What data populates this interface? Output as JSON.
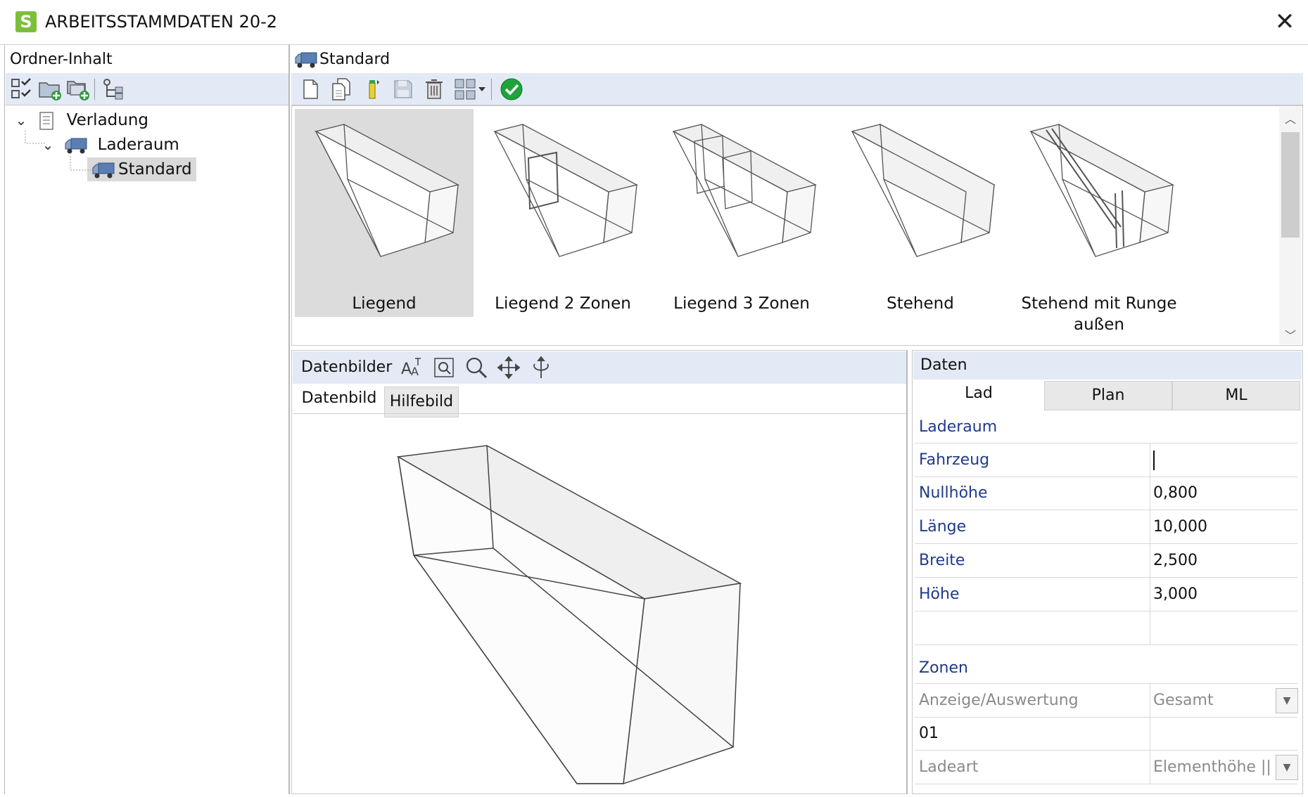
{
  "window": {
    "title": "ARBEITSSTAMMDATEN 20-2",
    "app_icon_letter": "S",
    "close_glyph": "✕"
  },
  "left": {
    "header": "Ordner-Inhalt",
    "toolbar": [
      "checklist-icon",
      "folder-add-icon",
      "folder-copy-add-icon",
      "tree-view-icon"
    ],
    "tree": [
      {
        "label": "Verladung",
        "level": 0,
        "expanded": true
      },
      {
        "label": "Laderaum",
        "level": 1,
        "expanded": true
      },
      {
        "label": "Standard",
        "level": 2,
        "selected": true
      }
    ]
  },
  "right": {
    "header": "Standard",
    "toolbar": [
      "new-doc-icon",
      "copy-doc-icon",
      "edit-icon",
      "save-icon",
      "delete-icon",
      "view-mode-icon",
      "dropdown-arrow-icon",
      "ok-check-icon"
    ]
  },
  "gallery": {
    "items": [
      {
        "label": "Liegend",
        "selected": true
      },
      {
        "label": "Liegend 2 Zonen"
      },
      {
        "label": "Liegend 3 Zonen"
      },
      {
        "label": "Stehend"
      },
      {
        "label": "Stehend mit Runge außen"
      }
    ]
  },
  "datenbilder": {
    "title": "Datenbilder",
    "tools": [
      "text-size-icon",
      "zoom-fit-icon",
      "zoom-icon",
      "pan-icon",
      "rotate-icon"
    ],
    "tabs": [
      "Datenbild",
      "Hilfebild"
    ]
  },
  "daten": {
    "title": "Daten",
    "tabs": [
      "Lad",
      "Plan",
      "ML"
    ],
    "section1": "Laderaum",
    "fields": [
      {
        "label": "Fahrzeug",
        "value": ""
      },
      {
        "label": "Nullhöhe",
        "value": "0,800"
      },
      {
        "label": "Länge",
        "value": "10,000"
      },
      {
        "label": "Breite",
        "value": "2,500"
      },
      {
        "label": "Höhe",
        "value": "3,000"
      }
    ],
    "section2": "Zonen",
    "zone_rows": [
      {
        "label": "Anzeige/Auswertung",
        "value": "Gesamt"
      },
      {
        "label": "01",
        "value": ""
      },
      {
        "label": "Ladeart",
        "value": "Elementhöhe || L"
      }
    ]
  },
  "colors": {
    "toolbar_bg": "#e3eaf6",
    "label_blue": "#1f3a8a",
    "ok_green": "#1fa33a",
    "app_green": "#7cbf3b"
  }
}
